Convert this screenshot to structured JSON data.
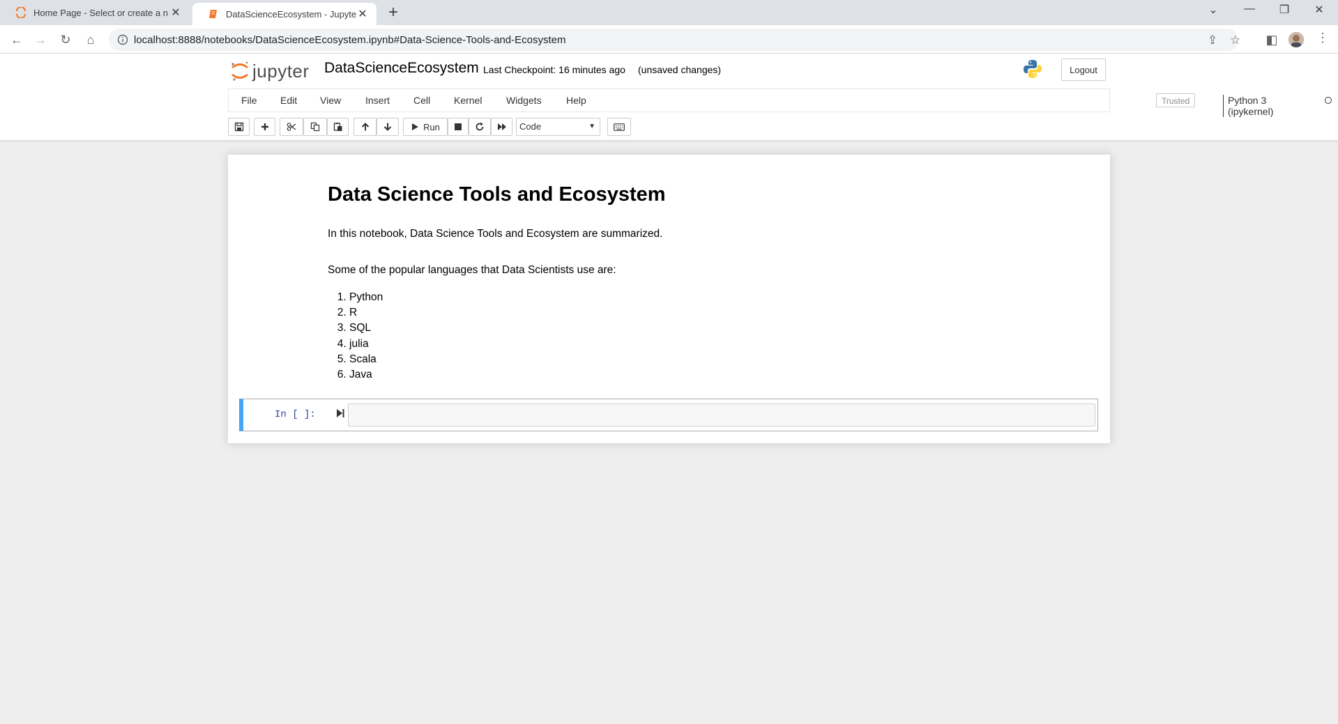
{
  "browser": {
    "tabs": [
      {
        "title": "Home Page - Select or create a n",
        "active": false,
        "icon": "jupyter-spinner-icon"
      },
      {
        "title": "DataScienceEcosystem - Jupyter N",
        "active": true,
        "icon": "notebook-icon"
      }
    ],
    "url": "localhost:8888/notebooks/DataScienceEcosystem.ipynb#Data-Science-Tools-and-Ecosystem"
  },
  "header": {
    "logo_text": "jupyter",
    "notebook_name": "DataScienceEcosystem",
    "checkpoint": "Last Checkpoint: 16 minutes ago",
    "save_status": "(unsaved changes)",
    "logout_label": "Logout"
  },
  "menu": {
    "items": [
      "File",
      "Edit",
      "View",
      "Insert",
      "Cell",
      "Kernel",
      "Widgets",
      "Help"
    ],
    "trusted": "Trusted",
    "kernel": "Python 3 (ipykernel)"
  },
  "toolbar": {
    "run_label": "Run",
    "cell_type": "Code"
  },
  "notebook": {
    "heading": "Data Science Tools and Ecosystem",
    "intro": "In this notebook, Data Science Tools and Ecosystem are summarized.",
    "languages_intro": "Some of the popular languages that Data Scientists use are:",
    "languages": [
      "Python",
      "R",
      "SQL",
      "julia",
      "Scala",
      "Java"
    ],
    "code_prompt": "In [ ]:"
  },
  "colors": {
    "accent": "#42a5f5",
    "jupyter_orange": "#f37726",
    "prompt": "#303f9f"
  }
}
